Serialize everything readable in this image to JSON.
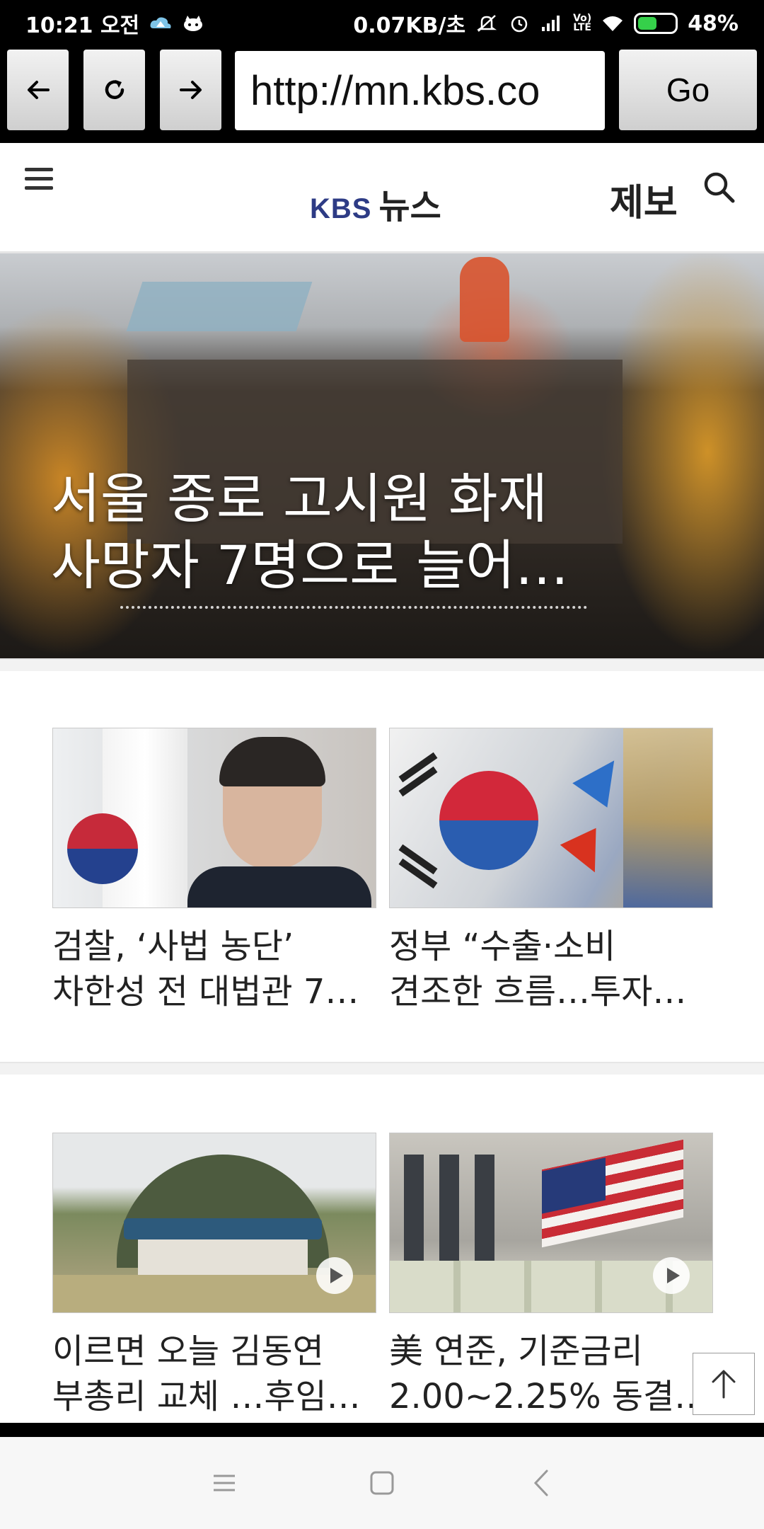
{
  "status_bar": {
    "time": "10:21 오전",
    "net_speed": "0.07KB/초",
    "network_label": "LTE",
    "battery": "48%",
    "icons": [
      "cloud-icon",
      "notification-app-icon",
      "mute-icon",
      "alarm-icon",
      "signal-icon",
      "volte-icon",
      "wifi-icon",
      "battery-charging-icon"
    ]
  },
  "browser": {
    "back_icon": "arrow-left-icon",
    "reload_icon": "reload-icon",
    "forward_icon": "arrow-right-icon",
    "url": "http://mn.kbs.co",
    "go_label": "Go"
  },
  "header": {
    "logo_brand": "KBS",
    "logo_text": "뉴스",
    "tip_label": "제보",
    "menu_icon": "hamburger-menu-icon",
    "search_icon": "search-icon"
  },
  "hero": {
    "title_line1": "서울 종로 고시원 화재",
    "title_line2": "사망자 7명으로 늘어…"
  },
  "articles": [
    {
      "title": "검찰, ‘사법 농단’\n차한성 전 대법관 7…",
      "has_video": false
    },
    {
      "title": "정부 “수출·소비\n견조한 흐름…투자…",
      "has_video": false
    },
    {
      "title": "이르면 오늘 김동연\n부총리 교체 …후임…",
      "has_video": true
    },
    {
      "title": "美 연준, 기준금리\n2.00~2.25% 동결…",
      "has_video": true
    }
  ],
  "colors": {
    "kbs_blue": "#2d3b85",
    "status_bar_bg": "#000000",
    "battery_green": "#35d04a"
  }
}
